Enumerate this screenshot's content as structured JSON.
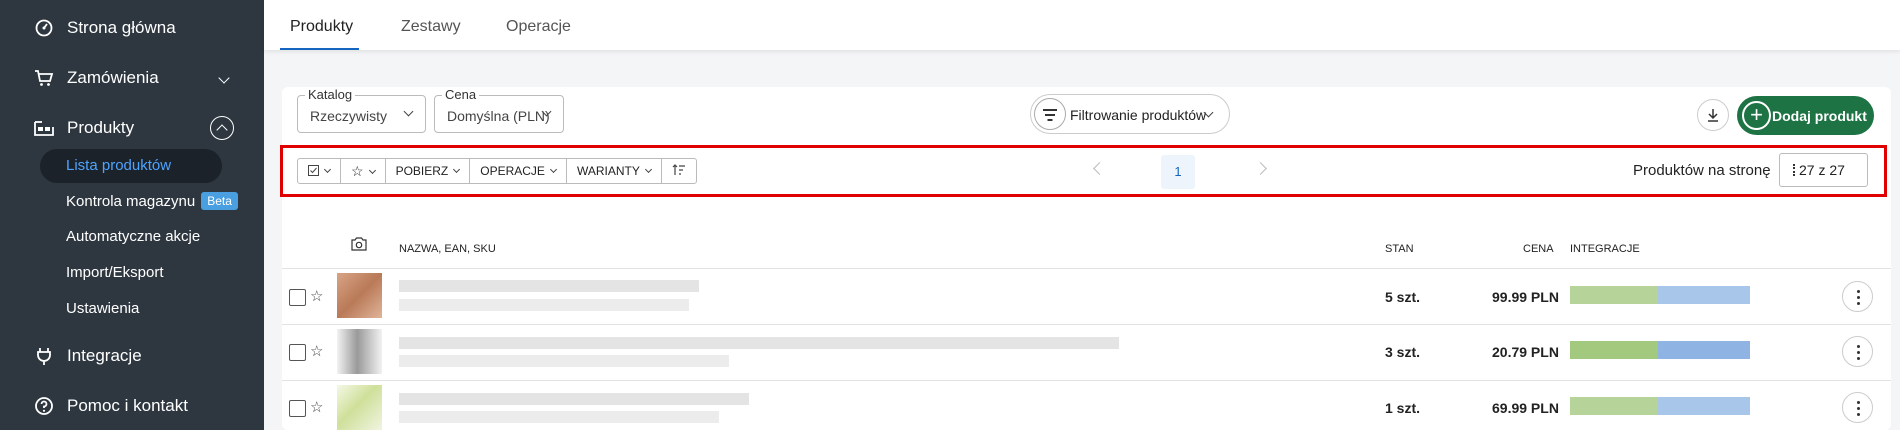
{
  "sidebar": {
    "home": "Strona główna",
    "orders": "Zamówienia",
    "products": "Produkty",
    "sub_items": [
      "Lista produktów",
      "Kontrola magazynu",
      "Automatyczne akcje",
      "Import/Eksport",
      "Ustawienia"
    ],
    "beta_badge": "Beta",
    "integrations": "Integracje",
    "help": "Pomoc i kontakt"
  },
  "tabs": [
    "Produkty",
    "Zestawy",
    "Operacje"
  ],
  "filters": {
    "catalog_label": "Katalog",
    "catalog_value": "Rzeczywisty",
    "price_label": "Cena",
    "price_value": "Domyślna (PLN)",
    "filter_button": "Filtrowanie produktów",
    "add_button": "Dodaj produkt"
  },
  "toolbar": {
    "download": "POBIERZ",
    "operations": "OPERACJE",
    "variants": "WARIANTY",
    "page": "1",
    "per_page_label": "Produktów na stronę",
    "per_page_value": "27 z 27"
  },
  "table": {
    "columns": {
      "name": "NAZWA, EAN, SKU",
      "stock": "STAN",
      "price": "CENA",
      "integrations": "INTEGRACJE"
    },
    "rows": [
      {
        "stock": "5 szt.",
        "price": "99.99 PLN"
      },
      {
        "stock": "3 szt.",
        "price": "20.79 PLN"
      },
      {
        "stock": "1 szt.",
        "price": "69.99 PLN"
      }
    ]
  },
  "colors": {
    "sidebar_bg": "#2e3740",
    "active_link": "#4ea3ff",
    "primary_green": "#1d7344",
    "highlight_frame": "#e00000"
  }
}
